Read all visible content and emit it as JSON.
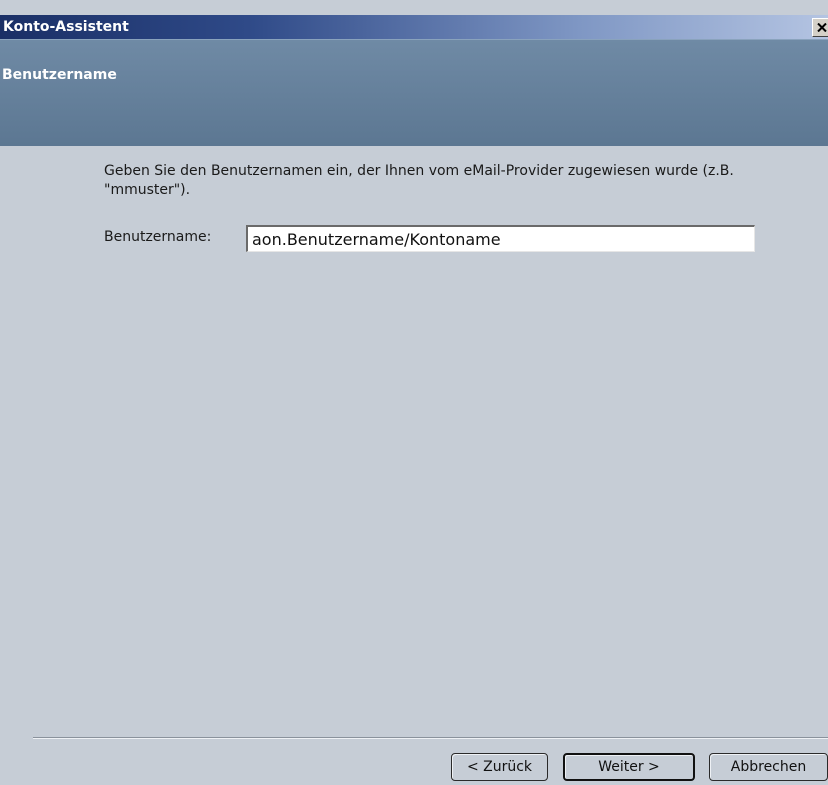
{
  "window": {
    "title": "Konto-Assistent",
    "close_icon": "close-icon"
  },
  "header": {
    "title": "Benutzername"
  },
  "main": {
    "instructions": "Geben Sie den Benutzernamen ein, der Ihnen vom eMail-Provider zugewiesen wurde (z.B. \"mmuster\").",
    "username_label": "Benutzername:",
    "username_value": "aon.Benutzername/Kontoname"
  },
  "buttons": {
    "back": "< Zurück",
    "next": "Weiter >",
    "cancel": "Abbrechen"
  },
  "colors": {
    "title_bar_start": "#1a2f66",
    "header_band": "#5c7792",
    "dialog_background": "#c6cdd6"
  }
}
